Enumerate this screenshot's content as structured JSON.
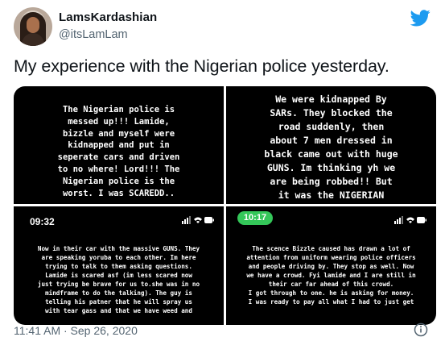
{
  "user": {
    "display_name": "LamsKardashian",
    "handle": "@itsLamLam"
  },
  "tweet": {
    "text": "My experience with the Nigerian police yesterday.",
    "timestamp": "11:41 AM · Sep 26, 2020"
  },
  "media": [
    {
      "status_time": "",
      "caption": "The Nigerian police is\nmessed up!!! Lamide,\nbizzle and myself were\nkidnapped and put in\nseperate cars and driven\nto no where! Lord!!! The\nNigerian police is the\nworst. I was SCAREDD.."
    },
    {
      "status_time": "",
      "caption": "We were kidnapped By\nSARs. They blocked the\nroad suddenly, then\nabout 7 men dressed  in\nblack came out with huge\nGUNS. Im thinking yh we\nare being robbed!! But\nit was the NIGERIAN"
    },
    {
      "status_time": "09:32",
      "caption": "Now in their car with the massive GUNS. They\nare speaking yoruba to each other. Im here\ntrying to talk to them asking questions.\nLamide is scared asf (im less scared now\njust trying be brave for us to.she was in no\nmindframe to do the talking). The guy is\ntelling his patner that he will spray us\nwith tear gass and that we have weed and"
    },
    {
      "status_time": "10:17",
      "caption": "The scence Bizzle caused has drawn a lot of\nattention from uniform wearing police officers\nand people driving by. They stop as well. Now\nwe have a crowd. Fyi lamide and I are still in\ntheir car far ahead of this crowd.\nI got through to one. he is asking for money.\nI was ready to pay all what I had to just get"
    }
  ],
  "icons": {
    "brand": "twitter-bird-icon",
    "info": "info-icon"
  },
  "colors": {
    "brand_blue": "#1d9bf0",
    "secondary_text": "#536471",
    "status_pill": "#34c759"
  }
}
